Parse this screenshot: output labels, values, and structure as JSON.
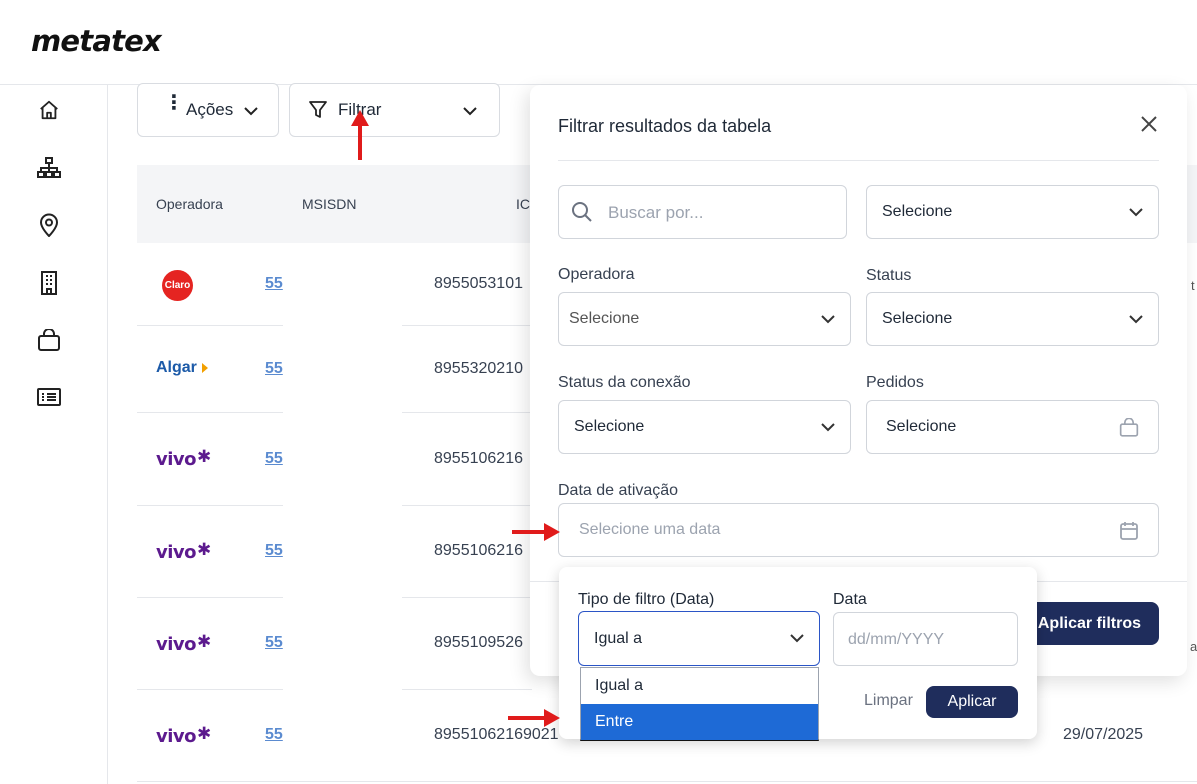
{
  "brand": {
    "logo": "metatex"
  },
  "toolbar": {
    "actions_label": "Ações",
    "filter_label": "Filtrar"
  },
  "table": {
    "headers": [
      "Operadora",
      "MSISDN",
      "IC"
    ],
    "rows": [
      {
        "operator": "Claro",
        "msisdn": "55",
        "iccid": "8955053101",
        "trailing": "t"
      },
      {
        "operator": "Algar",
        "msisdn": "55",
        "iccid": "8955320210",
        "trailing": ""
      },
      {
        "operator": "vivo",
        "msisdn": "55",
        "iccid": "8955106216",
        "trailing": ""
      },
      {
        "operator": "vivo",
        "msisdn": "55",
        "iccid": "8955106216",
        "trailing": ""
      },
      {
        "operator": "vivo",
        "msisdn": "55",
        "iccid": "8955109526",
        "trailing": "a"
      },
      {
        "operator": "vivo",
        "msisdn": "55",
        "iccid": "89551062169021",
        "date": "29/07/2025"
      }
    ]
  },
  "filter_panel": {
    "title": "Filtrar resultados da tabela",
    "search_placeholder": "Buscar por...",
    "search_scope_value": "Selecione",
    "operadora_label": "Operadora",
    "operadora_value": "Selecione",
    "status_label": "Status",
    "status_value": "Selecione",
    "conexao_label": "Status da conexão",
    "conexao_value": "Selecione",
    "pedidos_label": "Pedidos",
    "pedidos_value": "Selecione",
    "data_label": "Data de ativação",
    "data_placeholder": "Selecione uma data",
    "apply_label": "Aplicar filtros"
  },
  "date_popover": {
    "type_label": "Tipo de filtro (Data)",
    "type_value": "Igual a",
    "date_label": "Data",
    "date_placeholder": "dd/mm/YYYY",
    "clear_label": "Limpar",
    "apply_label": "Aplicar",
    "options": [
      "Igual a",
      "Entre"
    ],
    "highlighted_option": "Entre"
  },
  "colors": {
    "primary": "#1f2d5c",
    "highlight": "#1e6ad6",
    "vivo": "#5c1a8e",
    "claro": "#e52421",
    "annotation": "#e01b1b"
  }
}
